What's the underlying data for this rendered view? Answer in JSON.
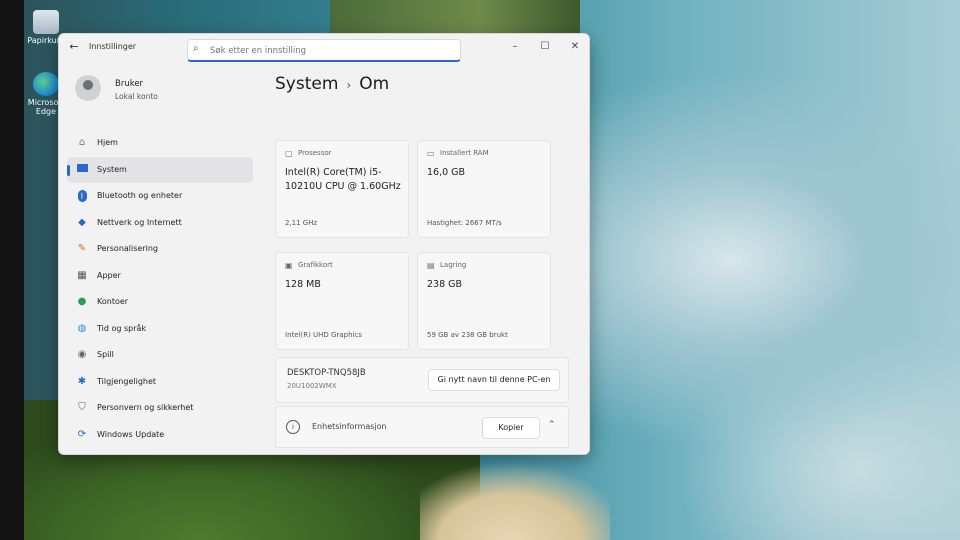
{
  "desktop": {
    "icons": [
      {
        "label": "Papirkurv",
        "icon": "recycle-bin-icon"
      },
      {
        "label": "Microsoft Edge",
        "icon": "edge-icon"
      }
    ]
  },
  "window": {
    "title": "Innstillinger",
    "search_placeholder": "Søk etter en innstilling",
    "controls": {
      "minimize": "–",
      "maximize": "☐",
      "close": "✕"
    }
  },
  "user": {
    "name": "Bruker",
    "account_type": "Lokal konto"
  },
  "nav": {
    "items": [
      {
        "label": "Hjem",
        "icon": "home-icon",
        "color": "#b06a3a"
      },
      {
        "label": "System",
        "icon": "system-icon",
        "color": "#2a67c9",
        "active": true
      },
      {
        "label": "Bluetooth og enheter",
        "icon": "bluetooth-icon",
        "color": "#2a67c9"
      },
      {
        "label": "Nettverk og Internett",
        "icon": "wifi-icon",
        "color": "#2a67c9"
      },
      {
        "label": "Personalisering",
        "icon": "brush-icon",
        "color": "#d06a2a"
      },
      {
        "label": "Apper",
        "icon": "apps-icon",
        "color": "#4a5560"
      },
      {
        "label": "Kontoer",
        "icon": "person-icon",
        "color": "#2e9b5a"
      },
      {
        "label": "Tid og språk",
        "icon": "globe-clock-icon",
        "color": "#2a8fc9"
      },
      {
        "label": "Spill",
        "icon": "gamepad-icon",
        "color": "#666"
      },
      {
        "label": "Tilgjengelighet",
        "icon": "accessibility-icon",
        "color": "#2a67c9"
      },
      {
        "label": "Personvern og sikkerhet",
        "icon": "shield-icon",
        "color": "#666"
      },
      {
        "label": "Windows Update",
        "icon": "update-icon",
        "color": "#2a67c9"
      }
    ]
  },
  "content": {
    "breadcrumb": {
      "parent": "System",
      "separator": "›",
      "current": "Om"
    },
    "cards": {
      "processor": {
        "label": "Prosessor",
        "value": "Intel(R) Core(TM) i5-10210U CPU @ 1.60GHz",
        "foot": "2,11 GHz"
      },
      "ram": {
        "label": "Installert RAM",
        "value": "16,0 GB",
        "foot": "Hastighet: 2667 MT/s"
      },
      "gpu": {
        "label": "Grafikkort",
        "value": "128 MB",
        "foot": "Intel(R) UHD Graphics"
      },
      "storage": {
        "label": "Lagring",
        "value": "238 GB",
        "foot": "59 GB av 238 GB brukt"
      }
    },
    "device": {
      "name": "DESKTOP-TNQ58JB",
      "model": "20U1002WMX",
      "rename_label": "Gi nytt navn til denne PC-en"
    },
    "device_info": {
      "label": "Enhetsinformasjon",
      "copy_label": "Kopier"
    }
  },
  "colors": {
    "accent": "#2a67c9"
  }
}
